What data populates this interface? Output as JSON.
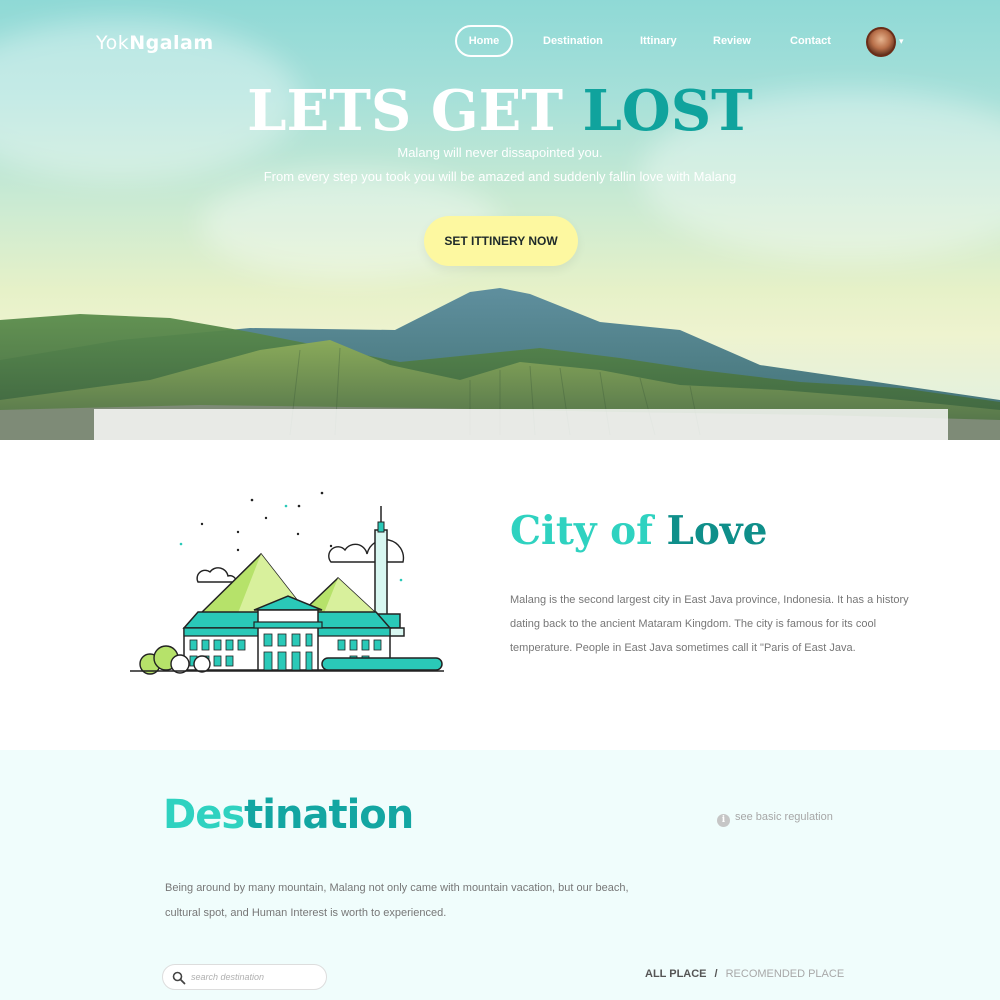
{
  "brand": {
    "name_light": "Yok",
    "name_bold": "Ngalam"
  },
  "nav": {
    "items": [
      {
        "label": "Home",
        "active": true
      },
      {
        "label": "Destination",
        "active": false
      },
      {
        "label": "Ittinary",
        "active": false
      },
      {
        "label": "Review",
        "active": false
      },
      {
        "label": "Contact",
        "active": false
      }
    ],
    "caret": "▾"
  },
  "hero": {
    "title_white": "LETS GET",
    "title_teal": "LOST",
    "subtitle_1": "Malang will never dissapointed you.",
    "subtitle_2": "From every step you took you will be amazed and suddenly fallin love with Malang",
    "cta_label": "SET ITTINERY NOW"
  },
  "city": {
    "title_a": "City of",
    "title_b": "Love",
    "text": "Malang is the second largest city in East Java province, Indonesia. It has a history dating back to the ancient Mataram Kingdom. The city is famous for its cool temperature. People in East Java sometimes call it \"Paris of East Java."
  },
  "destination": {
    "title_a": "Des",
    "title_b": "tination",
    "regulation_icon": "i",
    "regulation_label": "see basic regulation",
    "text": "Being around by many mountain, Malang not only came with mountain vacation, but our beach, cultural spot, and Human Interest is worth to experienced.",
    "search_placeholder": "search destination",
    "filter_all": "ALL PLACE",
    "filter_sep": "/",
    "filter_recommended": "RECOMENDED PLACE"
  },
  "colors": {
    "accent_teal": "#10a39d",
    "accent_mint": "#2fd2c0",
    "cta_yellow": "#fdf8a0",
    "section_bg": "#f0fdfc"
  }
}
